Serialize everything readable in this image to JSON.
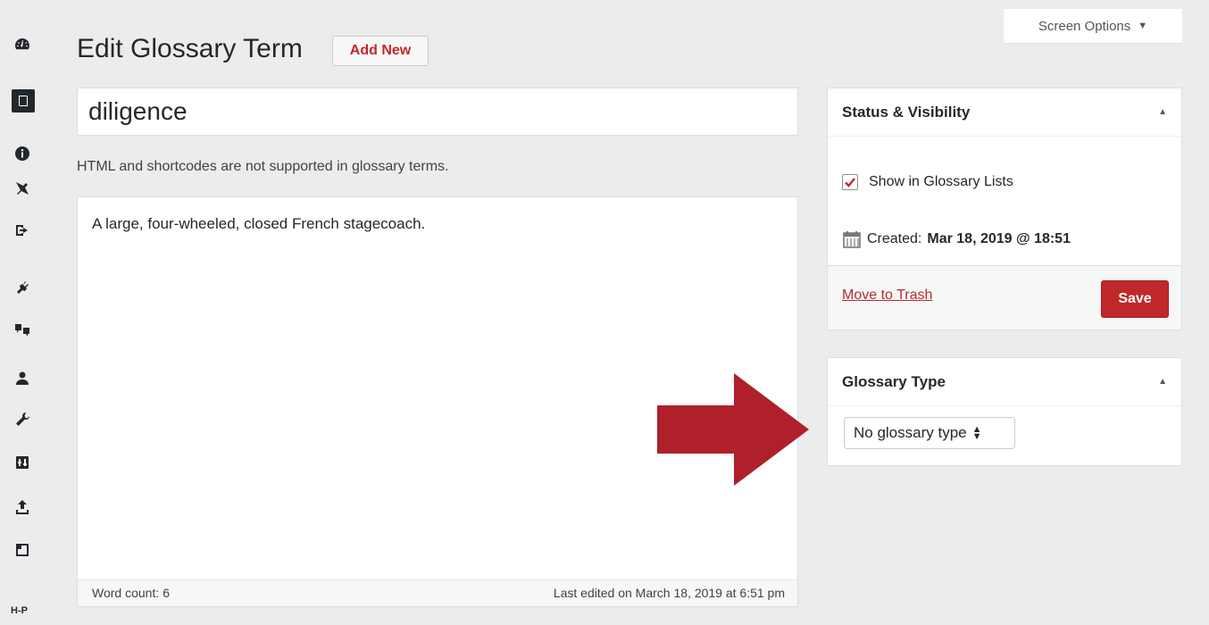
{
  "page": {
    "title": "Edit Glossary Term",
    "add_new_label": "Add New",
    "screen_options_label": "Screen Options",
    "caret": "▼"
  },
  "editor": {
    "term_title": "diligence",
    "notice": "HTML and shortcodes are not supported in glossary terms.",
    "content": "A large, four-wheeled, closed French stagecoach.",
    "word_count_label": "Word count:",
    "word_count": "6",
    "last_edited": "Last edited on March 18, 2019 at 6:51 pm"
  },
  "status_panel": {
    "heading": "Status & Visibility",
    "toggle": "▲",
    "show_in_lists_label": "Show in Glossary Lists",
    "show_in_lists_checked": true,
    "created_label": "Created:",
    "created_date": "Mar 18, 2019 @ 18:51",
    "trash_label": "Move to Trash",
    "save_label": "Save"
  },
  "type_panel": {
    "heading": "Glossary Type",
    "toggle": "▲",
    "selected": "No glossary type"
  },
  "sidebar": {
    "items": [
      "dashboard-icon",
      "glossary-icon",
      "info-icon",
      "pin-icon",
      "export-icon",
      "plugins-icon",
      "translate-icon",
      "users-icon",
      "tools-icon",
      "settings-icon",
      "upload-icon",
      "layout-icon",
      "h5p-icon"
    ],
    "h5p_label": "H-P"
  },
  "colors": {
    "accent": "#c0282c",
    "background": "#ececec",
    "sidebar_text": "#23282d"
  }
}
